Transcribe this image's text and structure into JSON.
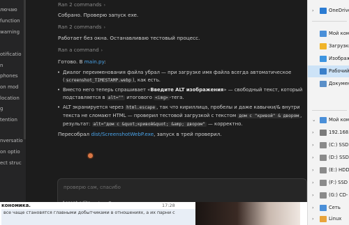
{
  "left_panel": {
    "items": [
      "лючаю",
      "function",
      "warning",
      "",
      "otificatio",
      "n",
      "phones",
      "on mod",
      "location",
      "g",
      "tention",
      "",
      "nversatio",
      "on optio",
      "ect struc"
    ]
  },
  "chat": {
    "ran1": "Ran 2 commands",
    "msg1": "Собрано. Проверю запуск exe.",
    "ran2": "Ran 2 commands",
    "msg2": "Работает без окна. Останавливаю тестовый процесс.",
    "ran3": "Ran a command",
    "msg3_prefix": "Готово. В ",
    "msg3_link": "main.py",
    "msg3_suffix": ":",
    "b1_a": "Диалог переименования файла убрал — при загрузке имя файла всегда автоматическое (",
    "b1_code": "screenshot_TIMESTAMP.webp",
    "b1_b": "), как есть.",
    "b2_a": "Вместо него теперь спрашивает «",
    "b2_bold": "Введите ALT изображения",
    "b2_b": "» — свободный текст, который подставляется в ",
    "b2_code1": "alt=\"\"",
    "b2_c": " итогового ",
    "b2_code2": "<img>",
    "b2_d": "-тега.",
    "b3_a": "ALT экранируется через ",
    "b3_code1": "html.escape",
    "b3_b": ", так что кириллица, пробелы и даже кавычки/& внутри текста не сломают HTML — проверил тестовой загрузкой с текстом ",
    "b3_code2": "дом с \"кривой\" & двором",
    "b3_c": ", результат: ",
    "b3_code3": "alt=\"дом с &quot;кривой&quot; &amp; двором\"",
    "b3_d": " — корректно.",
    "msg4_prefix": "Пересобрал ",
    "msg4_link": "dist/ScreenshotWebP.exe",
    "msg4_suffix": ", запуск в трей проверил."
  },
  "input": {
    "placeholder": "проверю сам, спасибо",
    "accept_edits": "Accept edits",
    "plus": "+",
    "slash": "⊕"
  },
  "explorer": {
    "items": [
      {
        "label": "OneDrive",
        "chev": "›",
        "color": "#2b7cd3"
      },
      {
        "label": "Мой компьютер",
        "chev": "",
        "color": "#4a8fd8"
      },
      {
        "label": "Загрузки",
        "chev": "",
        "color": "#f0b429"
      },
      {
        "label": "Изображения",
        "chev": "",
        "color": "#3e95e0"
      },
      {
        "label": "Рабочий стол",
        "chev": "",
        "color": "#3a7fc9"
      },
      {
        "label": "Документы",
        "chev": "",
        "color": "#5a8fc8"
      },
      {
        "label": "Мой компьютер",
        "chev": "⌄",
        "color": "#4a8fd8"
      },
      {
        "label": "192.168.",
        "chev": "›",
        "color": "#7a7a7a"
      },
      {
        "label": "(C:) SSD",
        "chev": "›",
        "color": "#8a8a8a"
      },
      {
        "label": "(D:) SSD",
        "chev": "›",
        "color": "#8a8a8a"
      },
      {
        "label": "(E:) HDD",
        "chev": "›",
        "color": "#8a8a8a"
      },
      {
        "label": "(F:) SSD",
        "chev": "›",
        "color": "#8a8a8a"
      },
      {
        "label": "(G:) CD-",
        "chev": "›",
        "color": "#8a8a8a"
      },
      {
        "label": "Сеть",
        "chev": "›",
        "color": "#4a8fd8"
      },
      {
        "label": "Linux",
        "chev": "›",
        "color": "#e8a33a"
      }
    ]
  },
  "bottom": {
    "title": "кономика.",
    "time": "17:28",
    "text": "все чаще становятся главными добытчиками в отношениях, а их парни с"
  },
  "colors": {
    "link": "#4aa3e8",
    "spinner": "#d97745",
    "selected": "#cde3f7"
  }
}
